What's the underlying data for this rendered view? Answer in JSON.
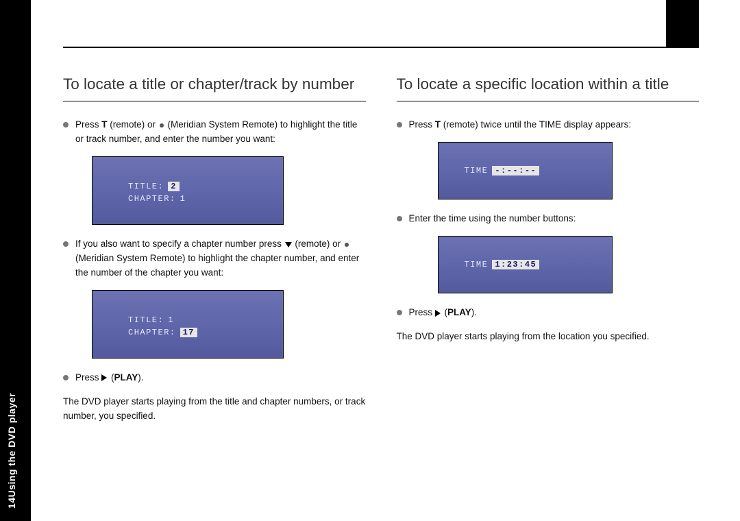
{
  "sidebar": {
    "page_number": "14",
    "section": "Using the DVD player"
  },
  "left": {
    "heading": "To locate a title or chapter/track by number",
    "li1_a": "Press ",
    "li1_key": "T",
    "li1_b": " (remote) or ",
    "li1_c": " (Meridian System Remote) to highlight the title or track number, and enter the number you want:",
    "shot1": {
      "title_label": "TITLE:",
      "title_value": "2",
      "chapter_label": "CHAPTER:",
      "chapter_value": "1"
    },
    "li2_a": "If you also want to specify a chapter number press ",
    "li2_b": " (remote) or ",
    "li2_c": " (Meridian System Remote) to highlight the chapter number, and enter the number of the chapter you want:",
    "shot2": {
      "title_label": "TITLE:",
      "title_value": "1",
      "chapter_label": "CHAPTER:",
      "chapter_value": "17"
    },
    "li3_a": "Press ",
    "li3_b": " (",
    "li3_key": "PLAY",
    "li3_c": ").",
    "outro": "The DVD player starts playing from the title and chapter numbers, or track number, you specified."
  },
  "right": {
    "heading": "To locate a specific location within a title",
    "li1_a": "Press ",
    "li1_key": "T",
    "li1_b": " (remote) twice until the TIME display appears:",
    "shot1": {
      "time_label": "TIME",
      "time_value": "-:--:--"
    },
    "li2": "Enter the time using the number buttons:",
    "shot2": {
      "time_label": "TIME",
      "time_value": "1:23:45"
    },
    "li3_a": "Press ",
    "li3_b": " (",
    "li3_key": "PLAY",
    "li3_c": ").",
    "outro": "The DVD player starts playing from the location you specified."
  }
}
